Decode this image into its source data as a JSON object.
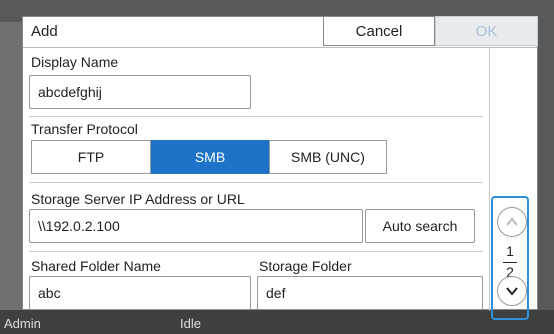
{
  "dialog": {
    "title": "Add",
    "cancel_label": "Cancel",
    "ok_label": "OK"
  },
  "display_name": {
    "label": "Display Name",
    "value": "abcdefghij"
  },
  "transfer_protocol": {
    "label": "Transfer Protocol",
    "options": [
      "FTP",
      "SMB",
      "SMB (UNC)"
    ],
    "selected": "SMB"
  },
  "storage_server": {
    "label": "Storage Server IP Address or URL",
    "value": "\\\\192.0.2.100",
    "auto_search_label": "Auto search"
  },
  "shared_folder": {
    "label": "Shared Folder Name",
    "value": "abc"
  },
  "storage_folder": {
    "label": "Storage Folder",
    "value": "def"
  },
  "pager": {
    "current": "1",
    "total": "2"
  },
  "background": {
    "user": "Admin",
    "status": "Idle"
  },
  "colors": {
    "accent": "#1e73c8",
    "pager_frame": "#2f8fd8"
  }
}
